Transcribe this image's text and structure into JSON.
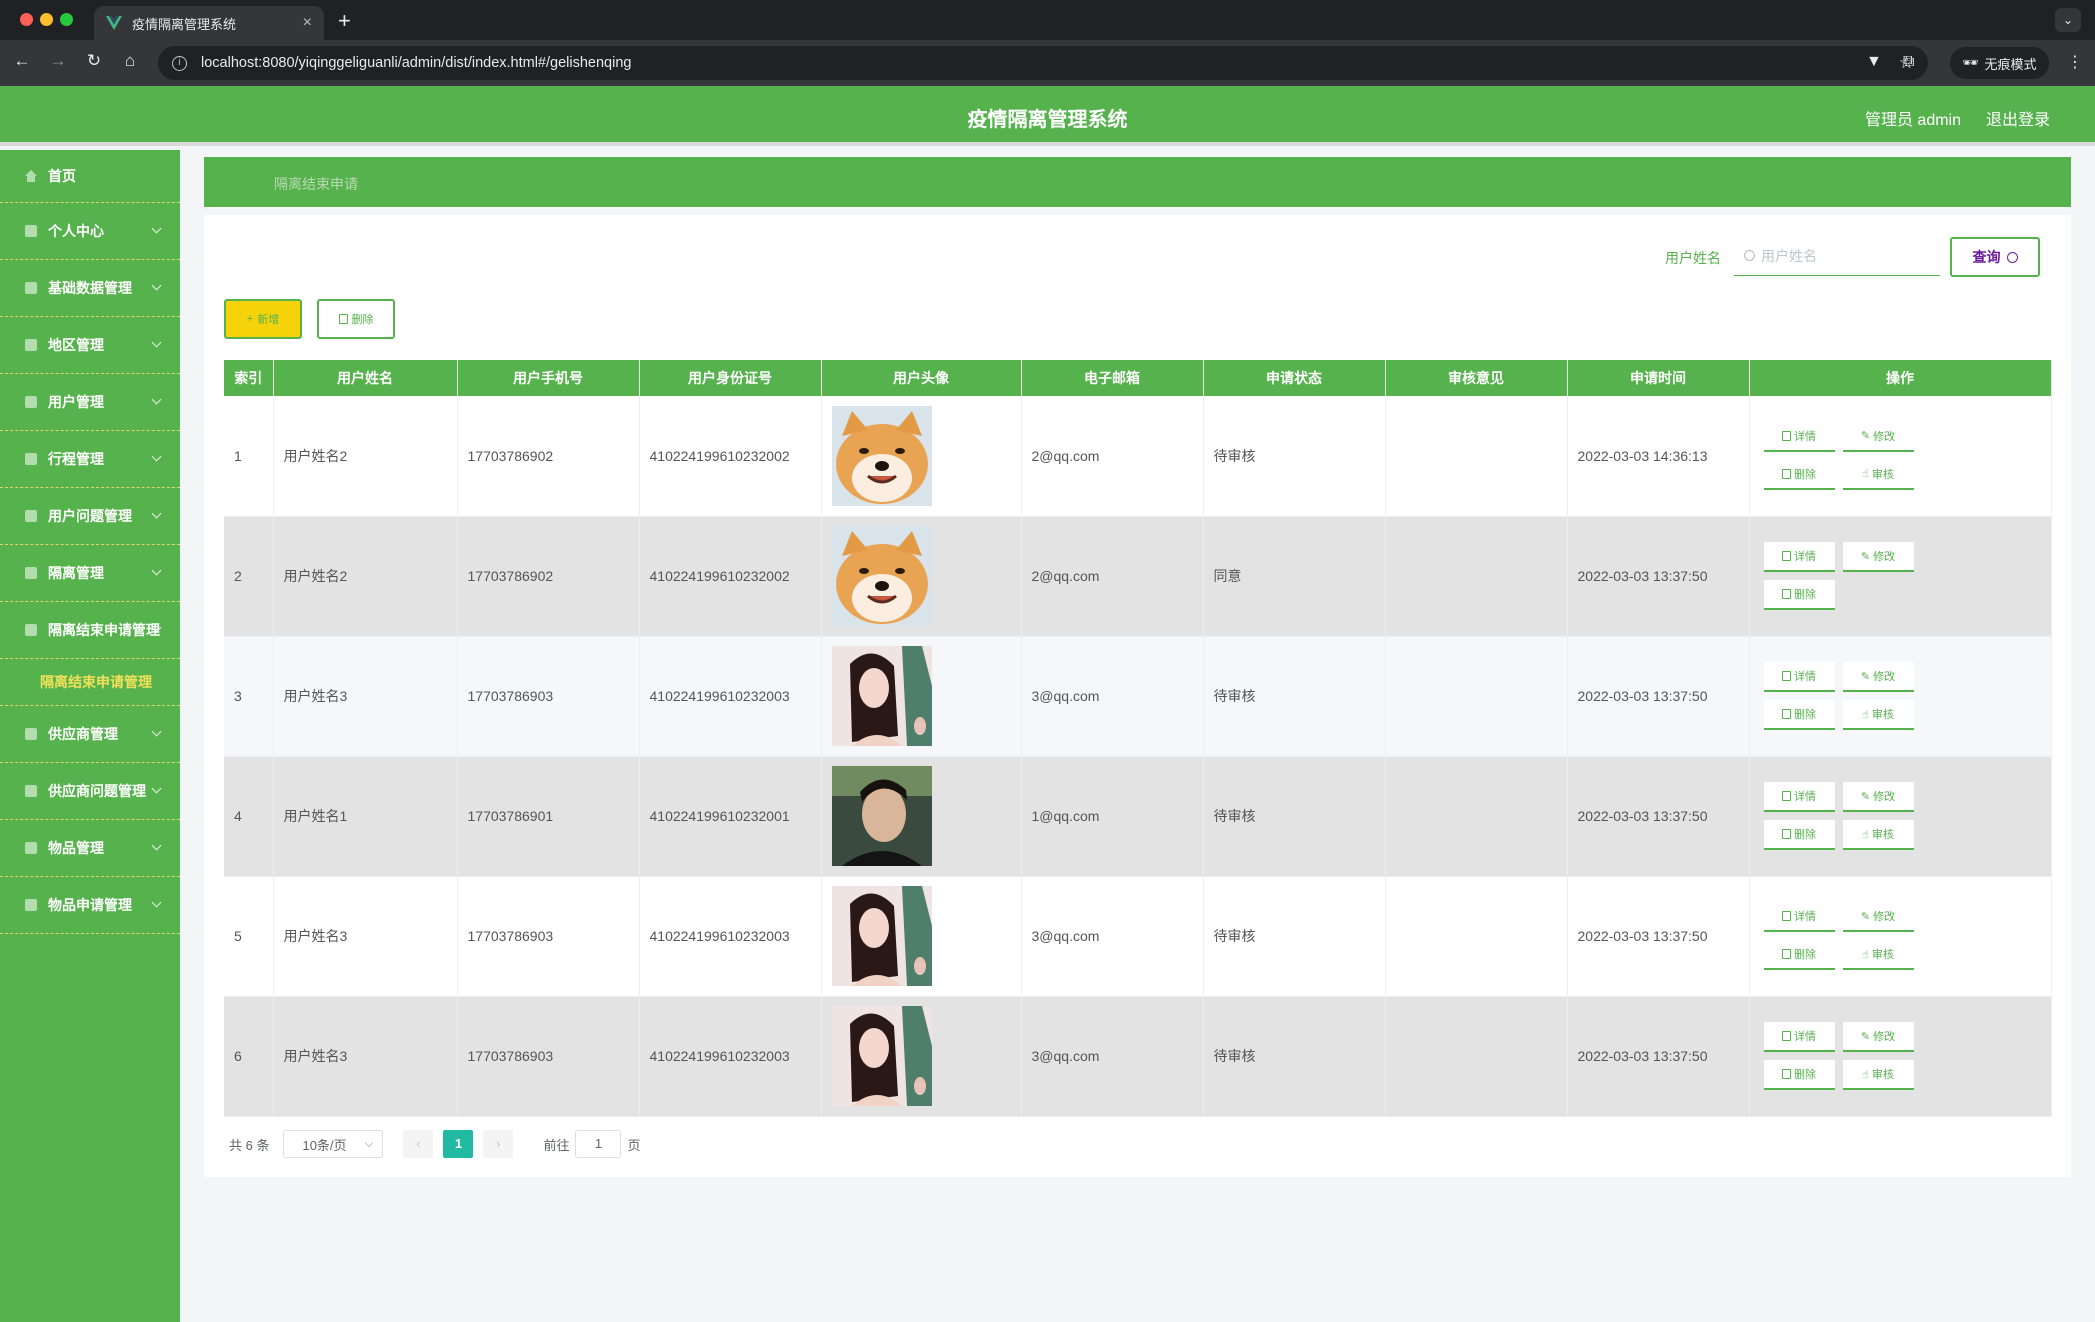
{
  "browser": {
    "tab_title": "疫情隔离管理系统",
    "url": "localhost:8080/yiqinggeliguanli/admin/dist/index.html#/gelishenqing",
    "incognito_label": "无痕模式"
  },
  "header": {
    "title": "疫情隔离管理系统",
    "user": "管理员 admin",
    "logout": "退出登录",
    "brand_color": "#56b24d"
  },
  "sidebar": {
    "home": "首页",
    "items": [
      "个人中心",
      "基础数据管理",
      "地区管理",
      "用户管理",
      "行程管理",
      "用户问题管理",
      "隔离管理",
      "隔离结束申请管理"
    ],
    "active_sub": "隔离结束申请管理",
    "items_after": [
      "供应商管理",
      "供应商问题管理",
      "物品管理",
      "物品申请管理"
    ]
  },
  "breadcrumb": "隔离结束申请",
  "search": {
    "label": "用户姓名",
    "placeholder": "用户姓名",
    "button": "查询"
  },
  "toolbar": {
    "add": "新增",
    "delete": "删除"
  },
  "table": {
    "columns": [
      "索引",
      "用户姓名",
      "用户手机号",
      "用户身份证号",
      "用户头像",
      "电子邮箱",
      "申请状态",
      "审核意见",
      "申请时间",
      "操作"
    ],
    "rows": [
      {
        "index": "1",
        "name": "用户姓名2",
        "phone": "17703786902",
        "id_card": "410224199610232002",
        "avatar": "dog",
        "email": "2@qq.com",
        "status": "待审核",
        "opinion": "",
        "time": "2022-03-03 14:36:13",
        "can_review": true
      },
      {
        "index": "2",
        "name": "用户姓名2",
        "phone": "17703786902",
        "id_card": "410224199610232002",
        "avatar": "dog",
        "email": "2@qq.com",
        "status": "同意",
        "opinion": "",
        "time": "2022-03-03 13:37:50",
        "can_review": false
      },
      {
        "index": "3",
        "name": "用户姓名3",
        "phone": "17703786903",
        "id_card": "410224199610232003",
        "avatar": "woman",
        "email": "3@qq.com",
        "status": "待审核",
        "opinion": "",
        "time": "2022-03-03 13:37:50",
        "can_review": true
      },
      {
        "index": "4",
        "name": "用户姓名1",
        "phone": "17703786901",
        "id_card": "410224199610232001",
        "avatar": "man",
        "email": "1@qq.com",
        "status": "待审核",
        "opinion": "",
        "time": "2022-03-03 13:37:50",
        "can_review": true
      },
      {
        "index": "5",
        "name": "用户姓名3",
        "phone": "17703786903",
        "id_card": "410224199610232003",
        "avatar": "woman",
        "email": "3@qq.com",
        "status": "待审核",
        "opinion": "",
        "time": "2022-03-03 13:37:50",
        "can_review": true
      },
      {
        "index": "6",
        "name": "用户姓名3",
        "phone": "17703786903",
        "id_card": "410224199610232003",
        "avatar": "woman",
        "email": "3@qq.com",
        "status": "待审核",
        "opinion": "",
        "time": "2022-03-03 13:37:50",
        "can_review": true
      }
    ],
    "ops": {
      "detail": "详情",
      "edit": "修改",
      "delete": "删除",
      "review": "审核"
    }
  },
  "pagination": {
    "total": "共 6 条",
    "page_size": "10条/页",
    "current": "1",
    "goto_label": "前往",
    "goto_value": "1",
    "page_suffix": "页"
  }
}
